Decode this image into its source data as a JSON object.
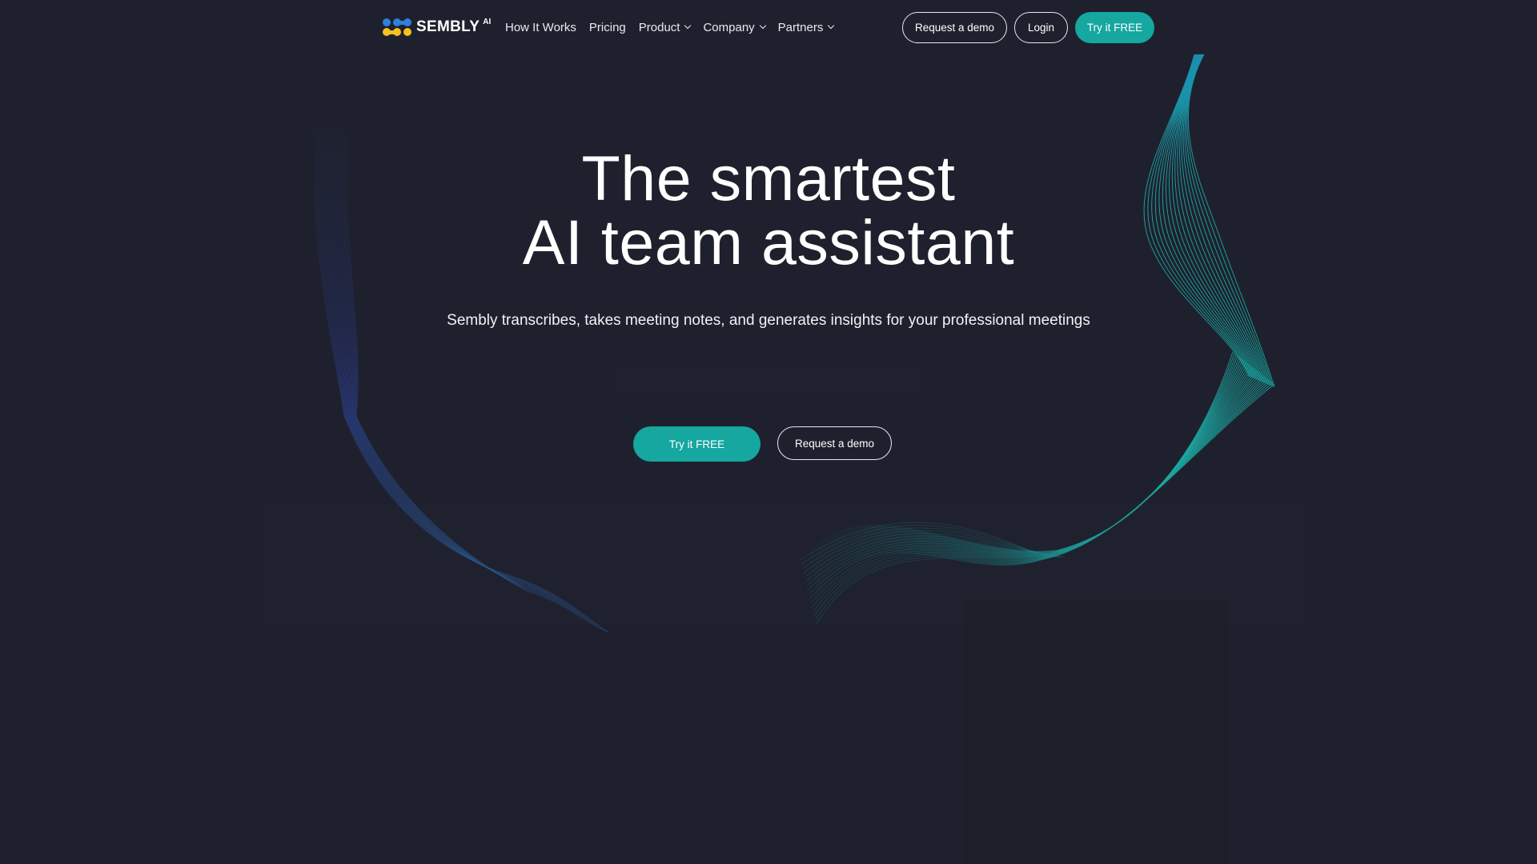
{
  "brand": {
    "name": "SEMBLY",
    "superscript": "AI",
    "colors": {
      "background": "#1e212d",
      "accent": "#15a7a0",
      "logo_blue": "#2f7ee0",
      "logo_yellow": "#f5c022",
      "wave_teal": "#1bb3ad",
      "wave_blue": "#2b3f9e"
    }
  },
  "nav": {
    "items": [
      {
        "label": "How It Works",
        "dropdown": false
      },
      {
        "label": "Pricing",
        "dropdown": false
      },
      {
        "label": "Product",
        "dropdown": true
      },
      {
        "label": "Company",
        "dropdown": true
      },
      {
        "label": "Partners",
        "dropdown": true
      }
    ]
  },
  "header_actions": {
    "request_demo": "Request a demo",
    "login": "Login",
    "try_free": "Try it FREE"
  },
  "hero": {
    "title_line1": "The smartest",
    "title_line2": "AI team assistant",
    "subtitle": "Sembly transcribes, takes meeting notes, and generates insights for your professional meetings",
    "cta_primary": "Try it FREE",
    "cta_secondary": "Request a demo"
  }
}
